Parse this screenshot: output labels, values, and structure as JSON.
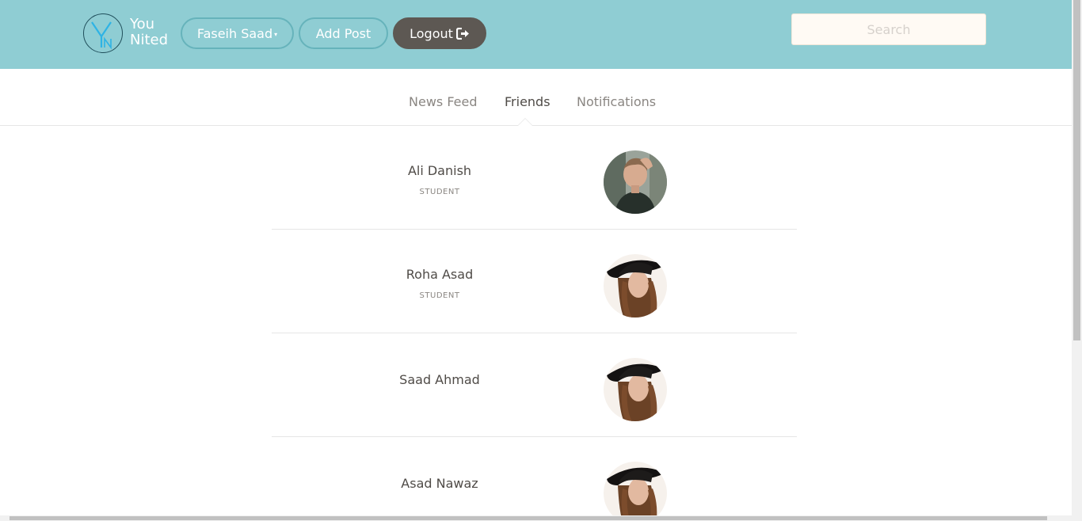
{
  "header": {
    "brand_line1": "You",
    "brand_line2": "Nited",
    "user_label": "Faseih Saad",
    "add_post_label": "Add Post",
    "logout_label": "Logout",
    "search_placeholder": "Search",
    "colors": {
      "bar": "#8fcdd3",
      "logout": "#5d5853",
      "logo_accent": "#2eb3e5"
    }
  },
  "tabs": [
    {
      "label": "News Feed",
      "active": false
    },
    {
      "label": "Friends",
      "active": true
    },
    {
      "label": "Notifications",
      "active": false
    }
  ],
  "friends": [
    {
      "name": "Ali Danish",
      "role": "STUDENT",
      "avatar": "man-avatar"
    },
    {
      "name": "Roha Asad",
      "role": "STUDENT",
      "avatar": "woman-hat-avatar"
    },
    {
      "name": "Saad Ahmad",
      "role": "",
      "avatar": "woman-hat-avatar"
    },
    {
      "name": "Asad Nawaz",
      "role": "",
      "avatar": "woman-hat-avatar"
    }
  ]
}
